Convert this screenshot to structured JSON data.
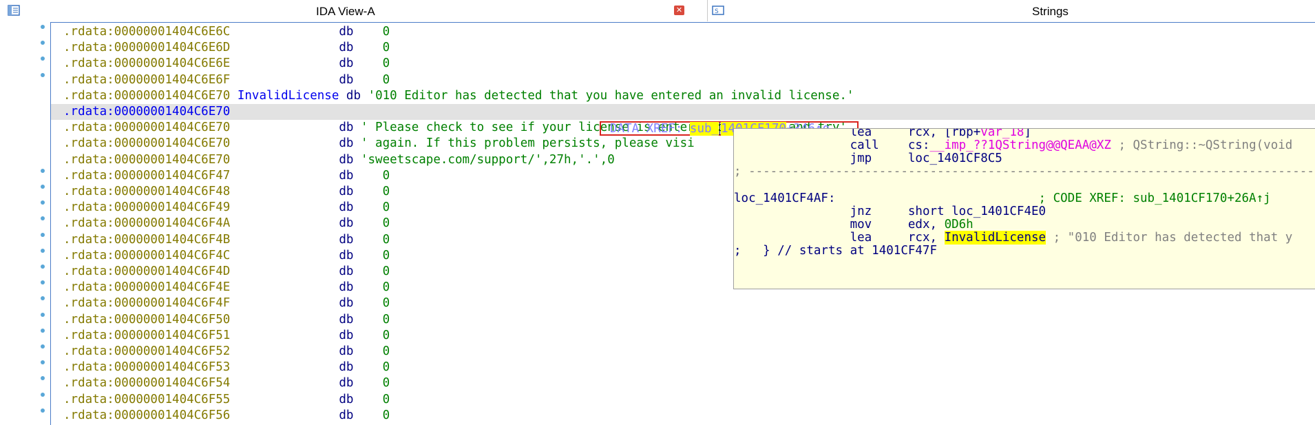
{
  "tabs": [
    {
      "title": "IDA View-A",
      "icon": "ida-view-icon",
      "closable": true
    },
    {
      "title": "Strings",
      "icon": "strings-icon",
      "closable": false
    }
  ],
  "listing": {
    "lines": [
      {
        "addr": ".rdata:00000001404C6E6C",
        "label": "",
        "op": "db",
        "val": "0",
        "dot": true
      },
      {
        "addr": ".rdata:00000001404C6E6D",
        "label": "",
        "op": "db",
        "val": "0",
        "dot": true
      },
      {
        "addr": ".rdata:00000001404C6E6E",
        "label": "",
        "op": "db",
        "val": "0",
        "dot": true
      },
      {
        "addr": ".rdata:00000001404C6E6F",
        "label": "",
        "op": "db",
        "val": "0",
        "dot": true
      },
      {
        "addr": ".rdata:00000001404C6E70",
        "label": "InvalidLicense",
        "op": "db",
        "val": "'010 Editor has detected that you have entered an invalid license.'",
        "dot": false
      },
      {
        "addr": ".rdata:00000001404C6E70",
        "label": "",
        "op": "",
        "val": "",
        "dot": false,
        "highlight": true
      },
      {
        "addr": ".rdata:00000001404C6E70",
        "label": "",
        "op": "db",
        "val": "' Please check to see if your license is entered correctly and try'",
        "dot": false
      },
      {
        "addr": ".rdata:00000001404C6E70",
        "label": "",
        "op": "db",
        "val": "' again. If this problem persists, please visi",
        "dot": false
      },
      {
        "addr": ".rdata:00000001404C6E70",
        "label": "",
        "op": "db",
        "val": "'sweetscape.com/support/',27h,'.',0",
        "dot": false
      },
      {
        "addr": ".rdata:00000001404C6F47",
        "label": "",
        "op": "db",
        "val": "0",
        "dot": true
      },
      {
        "addr": ".rdata:00000001404C6F48",
        "label": "",
        "op": "db",
        "val": "0",
        "dot": true
      },
      {
        "addr": ".rdata:00000001404C6F49",
        "label": "",
        "op": "db",
        "val": "0",
        "dot": true
      },
      {
        "addr": ".rdata:00000001404C6F4A",
        "label": "",
        "op": "db",
        "val": "0",
        "dot": true
      },
      {
        "addr": ".rdata:00000001404C6F4B",
        "label": "",
        "op": "db",
        "val": "0",
        "dot": true
      },
      {
        "addr": ".rdata:00000001404C6F4C",
        "label": "",
        "op": "db",
        "val": "0",
        "dot": true
      },
      {
        "addr": ".rdata:00000001404C6F4D",
        "label": "",
        "op": "db",
        "val": "0",
        "dot": true
      },
      {
        "addr": ".rdata:00000001404C6F4E",
        "label": "",
        "op": "db",
        "val": "0",
        "dot": true
      },
      {
        "addr": ".rdata:00000001404C6F4F",
        "label": "",
        "op": "db",
        "val": "0",
        "dot": true
      },
      {
        "addr": ".rdata:00000001404C6F50",
        "label": "",
        "op": "db",
        "val": "0",
        "dot": true
      },
      {
        "addr": ".rdata:00000001404C6F51",
        "label": "",
        "op": "db",
        "val": "0",
        "dot": true
      },
      {
        "addr": ".rdata:00000001404C6F52",
        "label": "",
        "op": "db",
        "val": "0",
        "dot": true
      },
      {
        "addr": ".rdata:00000001404C6F53",
        "label": "",
        "op": "db",
        "val": "0",
        "dot": true
      },
      {
        "addr": ".rdata:00000001404C6F54",
        "label": "",
        "op": "db",
        "val": "0",
        "dot": true
      },
      {
        "addr": ".rdata:00000001404C6F55",
        "label": "",
        "op": "db",
        "val": "0",
        "dot": true
      },
      {
        "addr": ".rdata:00000001404C6F56",
        "label": "",
        "op": "db",
        "val": "0",
        "dot": true
      }
    ],
    "xref": {
      "prefix": "DATA XREF: ",
      "sub": "sub_",
      "target": "1401CF170",
      "suffix": "+346↑o"
    }
  },
  "popup": {
    "lines": [
      {
        "indent": "         ",
        "mnem": "lea",
        "ops": "rcx, [rbp+",
        "var": "var_18",
        "tail": "]",
        "comment": ""
      },
      {
        "indent": "         ",
        "mnem": "call",
        "ops": "cs:",
        "var": "__imp_??1QString@@QEAA@XZ",
        "tail": "",
        "comment": " ; QString::~QString(void"
      },
      {
        "indent": "         ",
        "mnem": "jmp",
        "ops": "loc_1401CF8C5",
        "var": "",
        "tail": "",
        "comment": ""
      },
      {
        "raw": "; ---------------------------------------------------------------------------------------"
      },
      {
        "raw": ""
      },
      {
        "label": "loc_1401CF4AF:",
        "comment": "                            ; CODE XREF: sub_1401CF170+26A↑j"
      },
      {
        "indent": "         ",
        "mnem": "jnz",
        "ops": "short loc_1401CF4E0",
        "var": "",
        "tail": "",
        "comment": ""
      },
      {
        "indent": "         ",
        "mnem": "mov",
        "ops": "edx, ",
        "var": "0D6h",
        "tail": "",
        "comment": ""
      },
      {
        "indent": "         ",
        "mnem": "lea",
        "ops": "rcx, ",
        "var": "InvalidLicense",
        "tail": "",
        "comment": " ; \"010 Editor has detected that y"
      },
      {
        "raw": ";   } // starts at 1401CF47F"
      }
    ]
  },
  "colors": {
    "address": "#847a00",
    "keyword": "#000080",
    "string": "#008000",
    "name": "#0000ee",
    "popup_bg": "#ffffe1",
    "highlight": "#ffff00",
    "xref_box": "#d9241f"
  }
}
